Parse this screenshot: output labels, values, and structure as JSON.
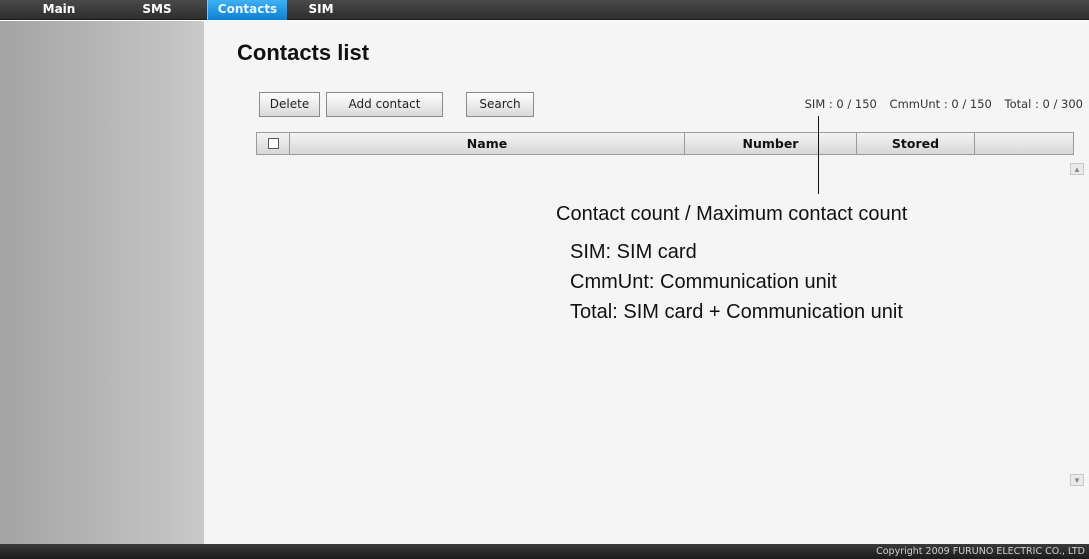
{
  "nav": {
    "tabs": [
      {
        "label": "Main"
      },
      {
        "label": "SMS"
      },
      {
        "label": "Contacts",
        "active": true
      },
      {
        "label": "SIM"
      }
    ]
  },
  "page": {
    "title": "Contacts list"
  },
  "toolbar": {
    "delete_label": "Delete",
    "add_label": "Add contact",
    "search_label": "Search"
  },
  "counts": {
    "sim": "SIM : 0 / 150",
    "cmmunt": "CmmUnt : 0 / 150",
    "total": "Total : 0 / 300"
  },
  "table": {
    "columns": [
      "",
      "Name",
      "Number",
      "Stored",
      ""
    ],
    "rows": []
  },
  "annotation": {
    "title": "Contact count / Maximum contact count",
    "lines": [
      "SIM: SIM card",
      "CmmUnt: Communication unit",
      "Total: SIM card + Communication unit"
    ]
  },
  "footer": {
    "copyright": "Copyright 2009 FURUNO ELECTRIC CO., LTD"
  },
  "colors": {
    "active_tab": "#1a8fdc",
    "sidebar": "#b4b4b4",
    "main_bg": "#f5f5f5"
  }
}
